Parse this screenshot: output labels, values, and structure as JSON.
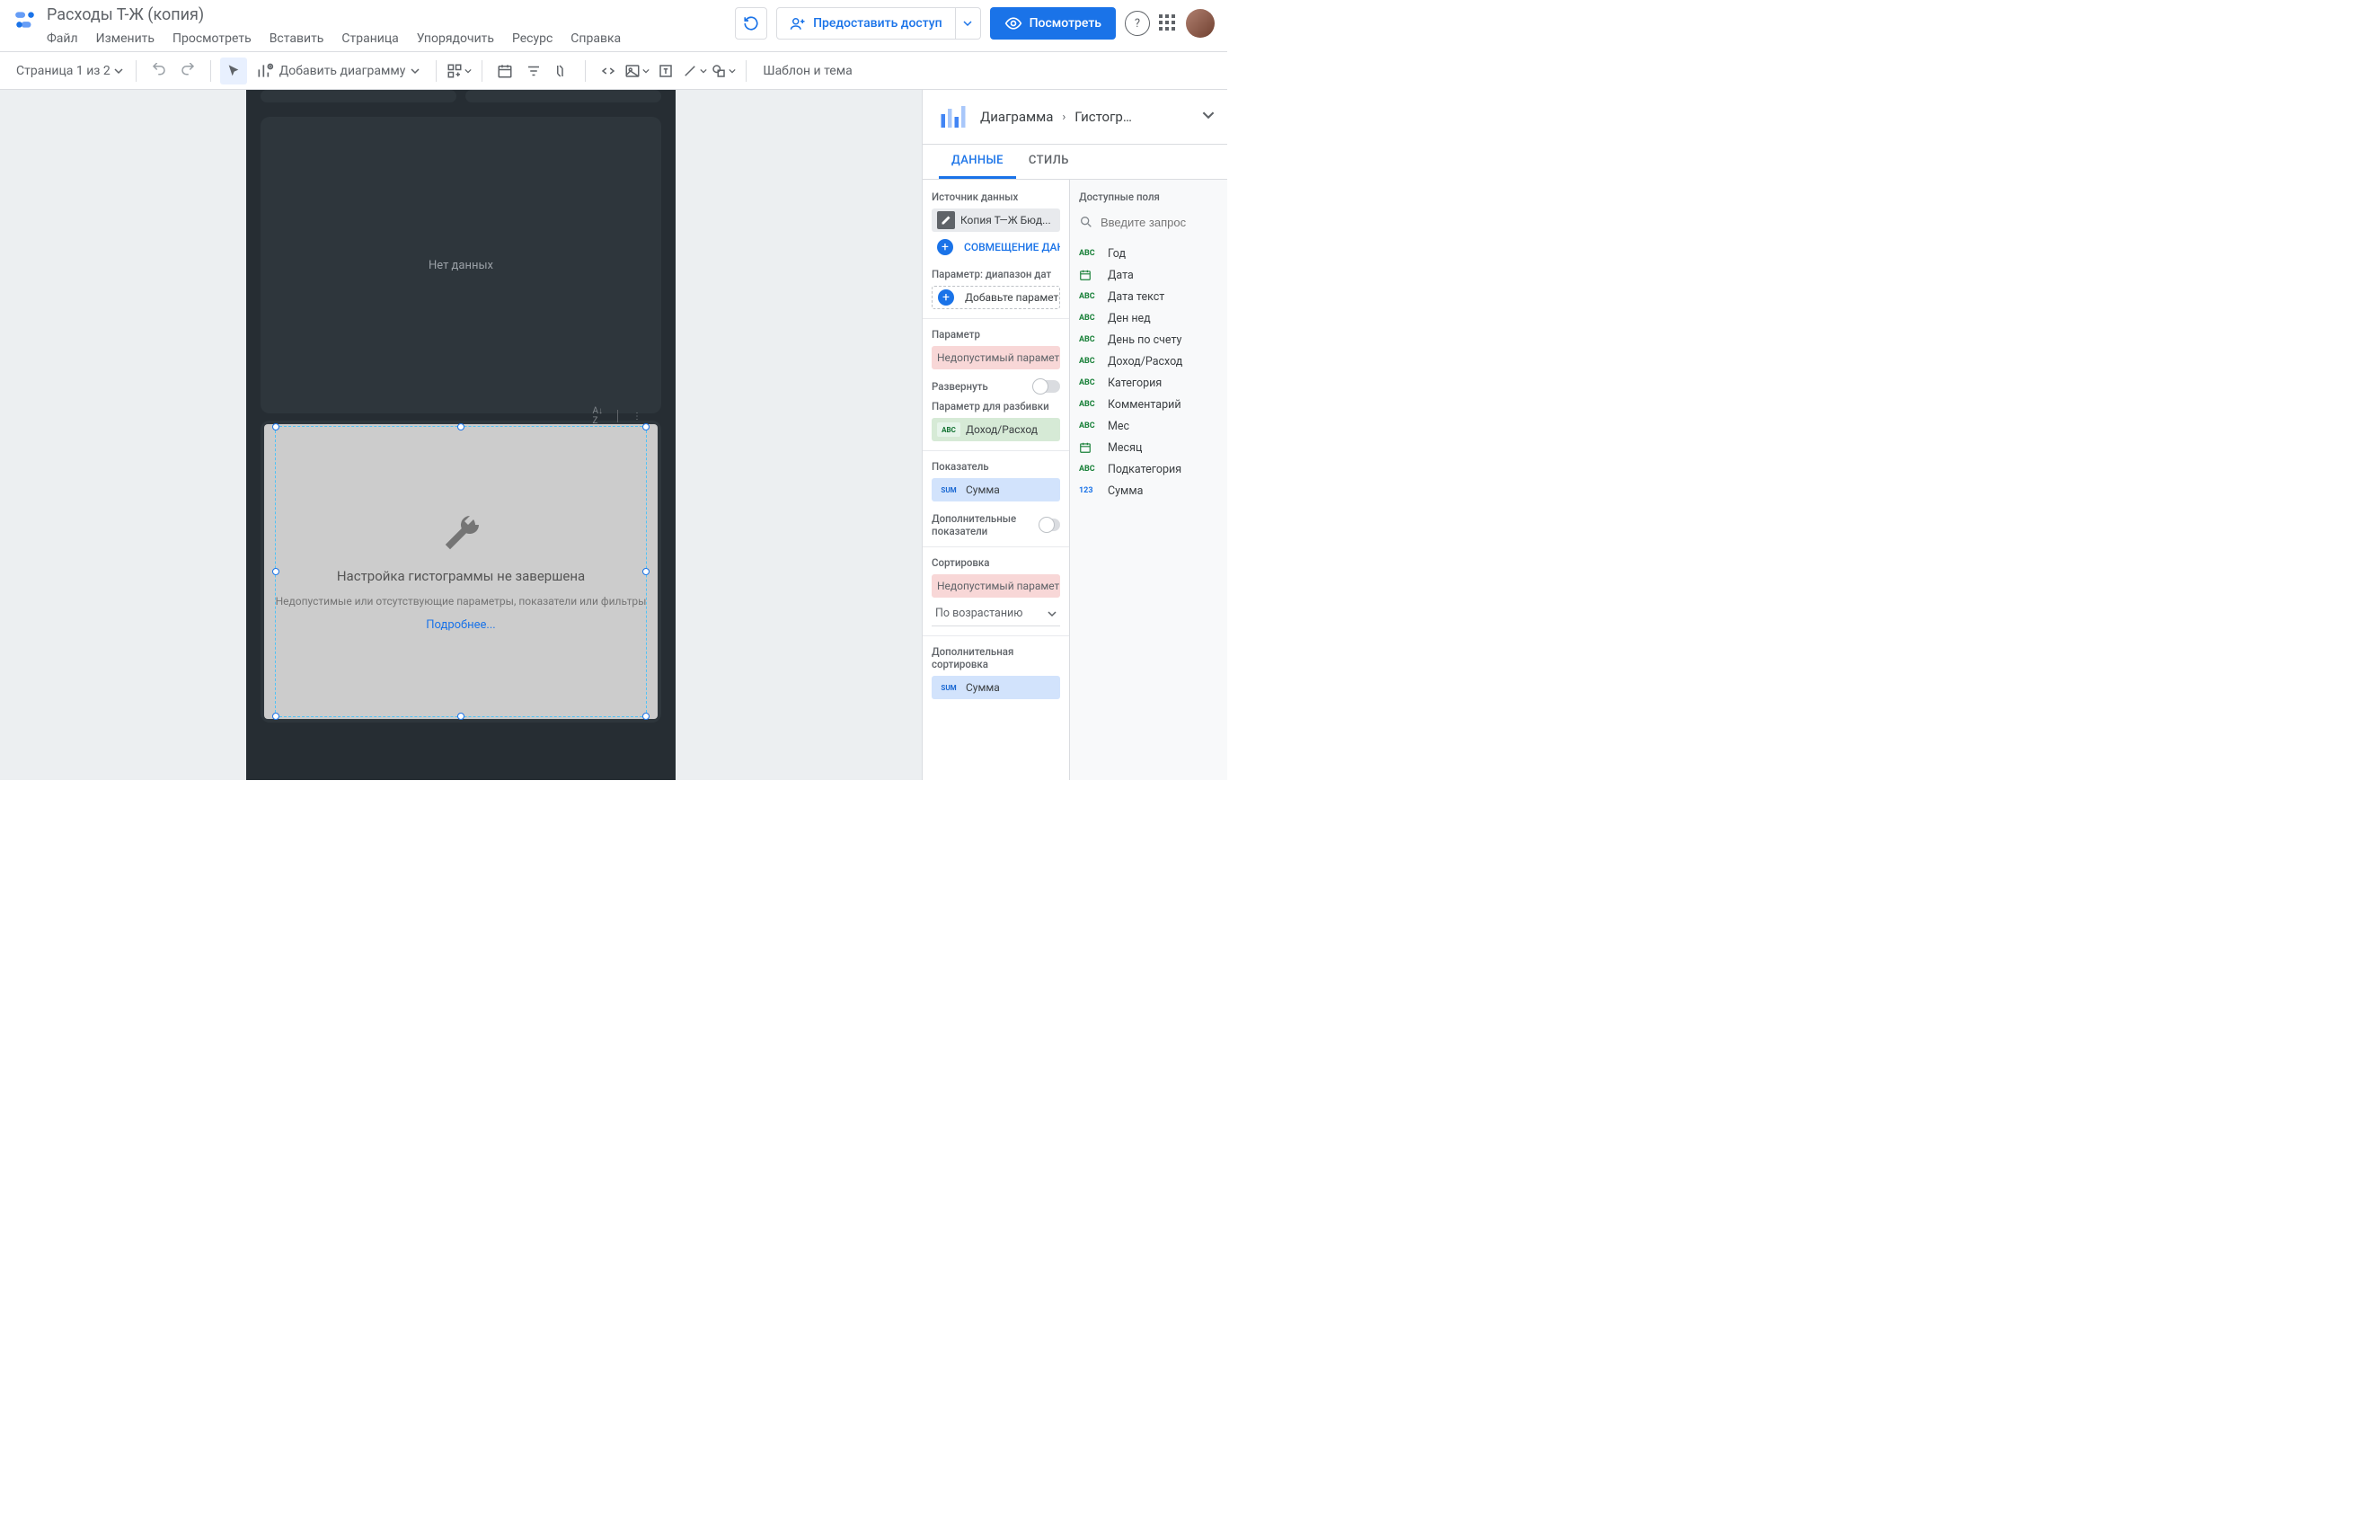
{
  "header": {
    "title": "Расходы Т-Ж (копия)",
    "menu": [
      "Файл",
      "Изменить",
      "Просмотреть",
      "Вставить",
      "Страница",
      "Упорядочить",
      "Ресурс",
      "Справка"
    ],
    "share": "Предоставить доступ",
    "view": "Посмотреть"
  },
  "toolbar": {
    "page_label": "Страница 1 из 2",
    "add_chart": "Добавить диаграмму",
    "theme": "Шаблон и тема"
  },
  "canvas": {
    "no_data": "Нет данных",
    "err_title": "Настройка гистограммы не завершена",
    "err_sub": "Недопустимые или отсутствующие параметры, показатели или фильтры",
    "err_link": "Подробнее..."
  },
  "panel": {
    "title": "Диаграмма",
    "crumb": "Гистогр…",
    "tabs": {
      "data": "ДАННЫЕ",
      "style": "СТИЛЬ"
    },
    "left": {
      "source_label": "Источник данных",
      "source_chip": "Копия Т—Ж Бюд...",
      "blend": "СОВМЕЩЕНИЕ ДАНН",
      "daterange_label": "Параметр: диапазон дат",
      "add_dim": "Добавьте параметр",
      "dim_label": "Параметр",
      "dim_err": "Недопустимый параметр.",
      "drill_label": "Развернуть",
      "breakdown_label": "Параметр для разбивки",
      "breakdown_chip": "Доход/Расход",
      "metric_label": "Показатель",
      "metric_chip": "Сумма",
      "opt_metrics_label": "Дополнительные показатели",
      "sort_label": "Сортировка",
      "sort_err": "Недопустимый параметр ...",
      "sort_dir": "По возрастанию",
      "sort2_label": "Дополнительная сортировка",
      "sort2_chip": "Сумма"
    },
    "right": {
      "avail_label": "Доступные поля",
      "search_ph": "Введите запрос",
      "fields": [
        {
          "t": "abc",
          "n": "Год"
        },
        {
          "t": "cal",
          "n": "Дата"
        },
        {
          "t": "abc",
          "n": "Дата текст"
        },
        {
          "t": "abc",
          "n": "Ден нед"
        },
        {
          "t": "abc",
          "n": "День по счету"
        },
        {
          "t": "abc",
          "n": "Доход/Расход"
        },
        {
          "t": "abc",
          "n": "Категория"
        },
        {
          "t": "abc",
          "n": "Комментарий"
        },
        {
          "t": "abc",
          "n": "Мес"
        },
        {
          "t": "cal",
          "n": "Месяц"
        },
        {
          "t": "abc",
          "n": "Подкатегория"
        },
        {
          "t": "num",
          "n": "Сумма"
        }
      ]
    }
  }
}
